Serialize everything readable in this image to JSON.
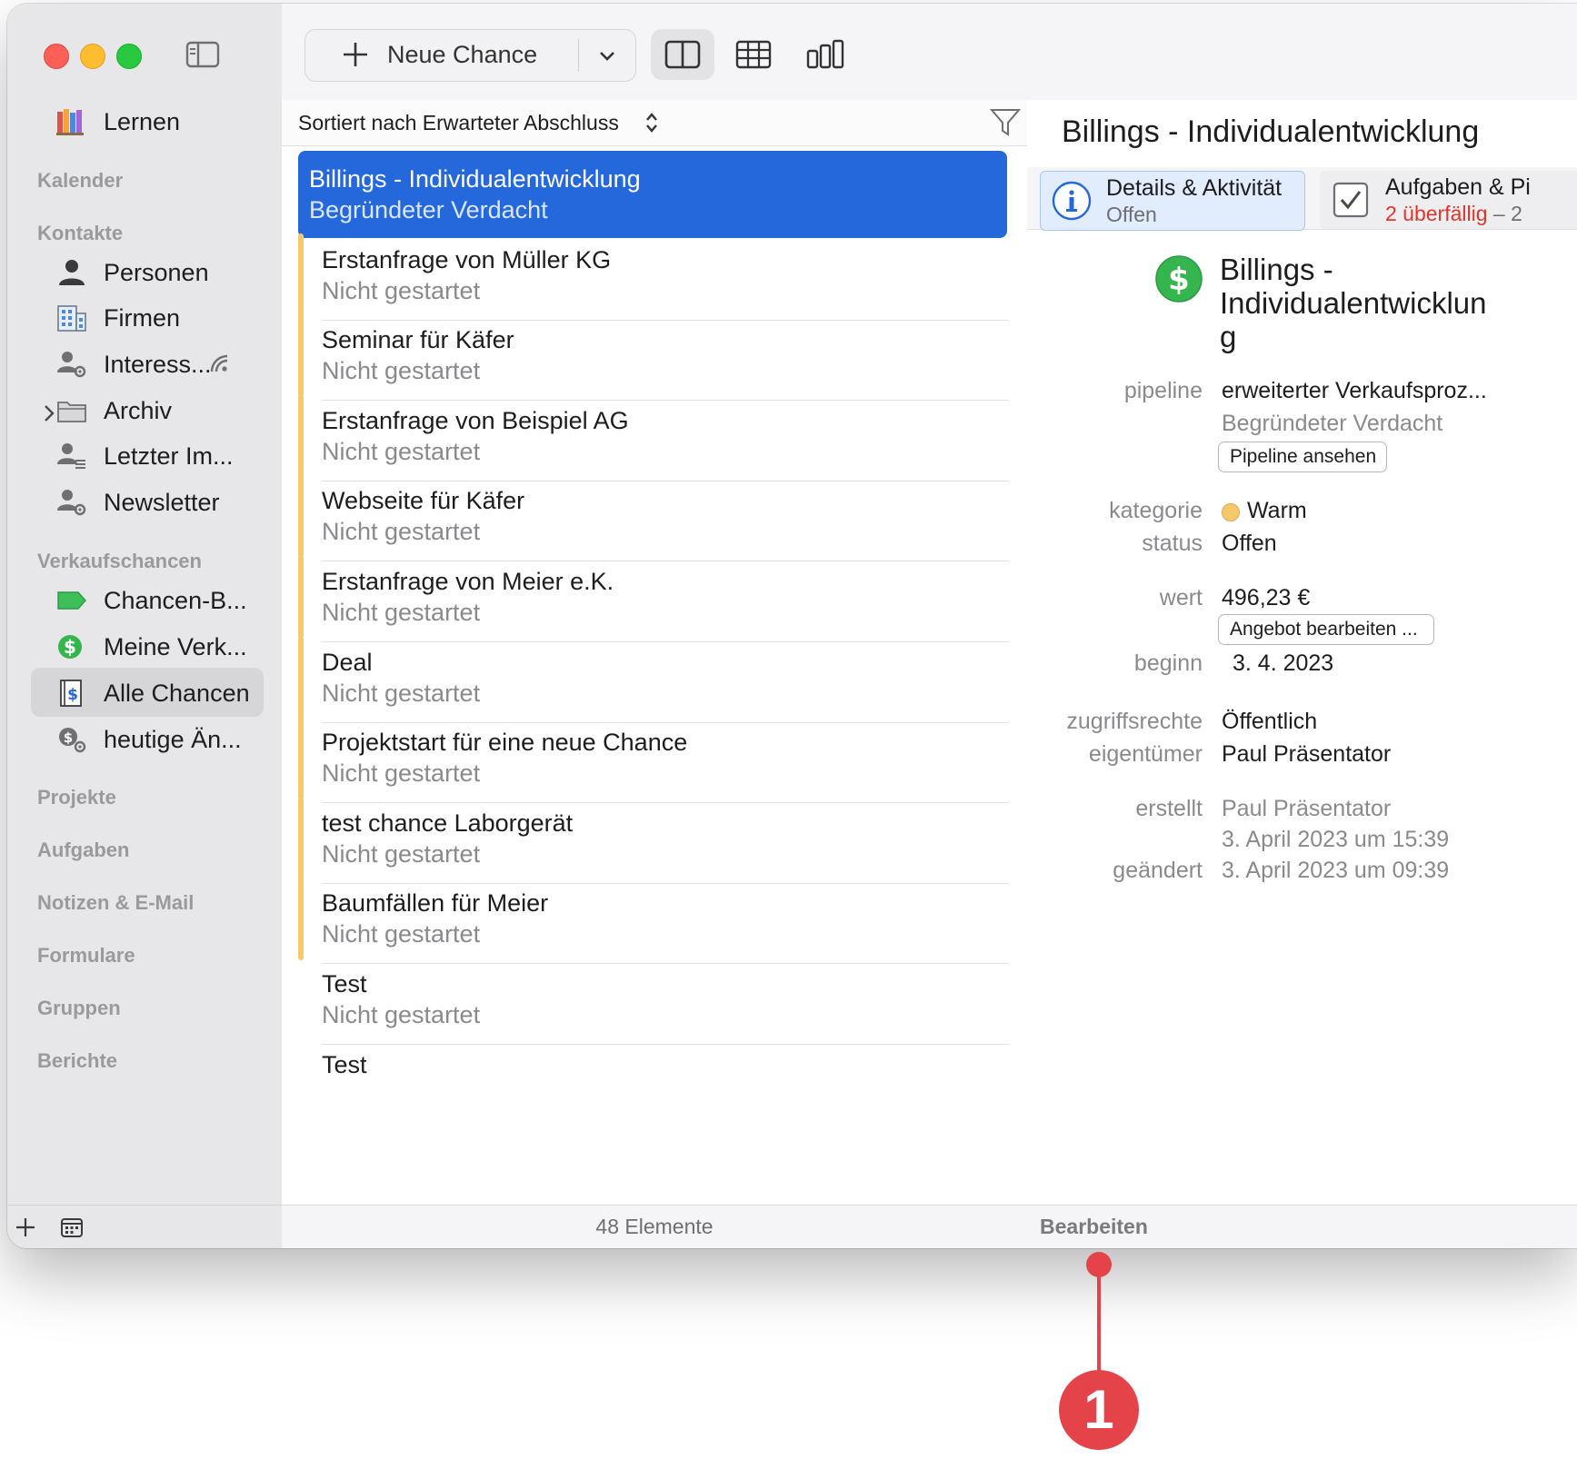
{
  "toolbar": {
    "new_button_label": "Neue Chance"
  },
  "sidebar": {
    "top_item": {
      "label": "Lernen",
      "icon": "books-icon"
    },
    "headers": {
      "kalender": "Kalender",
      "kontakte": "Kontakte",
      "verkaufschancen": "Verkaufschancen",
      "projekte": "Projekte",
      "aufgaben": "Aufgaben",
      "notizen": "Notizen & E-Mail",
      "formulare": "Formulare",
      "gruppen": "Gruppen",
      "berichte": "Berichte"
    },
    "contacts": [
      {
        "label": "Personen",
        "icon": "person-icon"
      },
      {
        "label": "Firmen",
        "icon": "building-icon"
      },
      {
        "label": "Interess...",
        "icon": "smart-group-icon"
      },
      {
        "label": "Archiv",
        "icon": "folder-icon"
      },
      {
        "label": "Letzter Im...",
        "icon": "import-list-icon"
      },
      {
        "label": "Newsletter",
        "icon": "smart-group-icon"
      }
    ],
    "opportunities": [
      {
        "label": "Chancen-B...",
        "icon": "tag-icon"
      },
      {
        "label": "Meine Verk...",
        "icon": "dollar-icon"
      },
      {
        "label": "Alle Chancen",
        "icon": "ledger-icon",
        "selected": true
      },
      {
        "label": "heutige Än...",
        "icon": "dollar-gear-icon"
      }
    ]
  },
  "list": {
    "sort_label": "Sortiert nach Erwarteter Abschluss",
    "footer_count": "48 Elemente",
    "rows": [
      {
        "title": "Billings - Individualentwicklung",
        "subtitle": "Begründeter Verdacht",
        "selected": true
      },
      {
        "title": "Erstanfrage von Müller KG",
        "subtitle": "Nicht gestartet"
      },
      {
        "title": "Seminar für Käfer",
        "subtitle": "Nicht gestartet"
      },
      {
        "title": "Erstanfrage von Beispiel AG",
        "subtitle": "Nicht gestartet"
      },
      {
        "title": "Webseite für Käfer",
        "subtitle": "Nicht gestartet"
      },
      {
        "title": "Erstanfrage von Meier e.K.",
        "subtitle": "Nicht gestartet"
      },
      {
        "title": "Deal",
        "subtitle": "Nicht gestartet"
      },
      {
        "title": "Projektstart für eine neue Chance",
        "subtitle": "Nicht gestartet"
      },
      {
        "title": "test chance Laborgerät",
        "subtitle": "Nicht gestartet"
      },
      {
        "title": "Baumfällen für Meier",
        "subtitle": "Nicht gestartet"
      },
      {
        "title": "Test",
        "subtitle": "Nicht gestartet"
      },
      {
        "title": "Test",
        "subtitle": ""
      }
    ]
  },
  "detail": {
    "title": "Billings - Individualentwicklung",
    "name_line1": "Billings -",
    "name_line2": "Individualentwicklun",
    "name_line3": "g",
    "tabs": [
      {
        "title": "Details & Aktivität",
        "subtitle": "Offen"
      },
      {
        "title": "Aufgaben & Pi",
        "overdue": "2 überfällig",
        "rest": " – 2"
      }
    ],
    "fields": {
      "pipeline_label": "pipeline",
      "pipeline_value": "erweiterter Verkaufsproz...",
      "pipeline_stage": "Begründeter Verdacht",
      "pipeline_button": "Pipeline ansehen",
      "kategorie_label": "kategorie",
      "kategorie_value": "Warm",
      "status_label": "status",
      "status_value": "Offen",
      "wert_label": "wert",
      "wert_value": "496,23 €",
      "wert_button": "Angebot bearbeiten ...",
      "beginn_label": "beginn",
      "beginn_value": "3.  4. 2023",
      "zugriff_label": "zugriffsrechte",
      "zugriff_value": "Öffentlich",
      "eigentuemer_label": "eigentümer",
      "eigentuemer_value": "Paul Präsentator",
      "erstellt_label": "erstellt",
      "erstellt_value": "Paul Präsentator",
      "erstellt_date": "3. April 2023 um 15:39",
      "geaendert_label": "geändert",
      "geaendert_value": "3. April 2023 um 09:39"
    },
    "footer_edit": "Bearbeiten"
  },
  "callout": {
    "number": "1"
  },
  "colors": {
    "selection": "#2468dc",
    "category_warm": "#f5c96a",
    "overdue": "#e0352b",
    "callout": "#e5434a"
  }
}
